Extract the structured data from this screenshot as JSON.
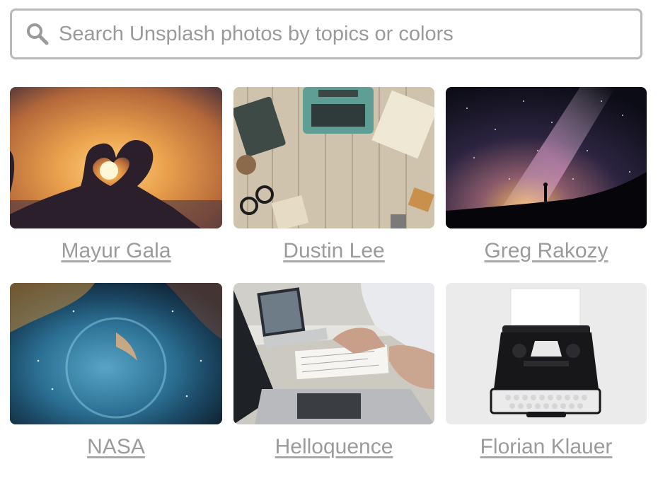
{
  "search": {
    "placeholder": "Search Unsplash photos by topics or colors",
    "icon": "search-icon"
  },
  "photos": [
    {
      "author": "Mayur Gala",
      "subject": "heart-hands-sunset"
    },
    {
      "author": "Dustin Lee",
      "subject": "typewriter-on-wood-desk"
    },
    {
      "author": "Greg Rakozy",
      "subject": "milky-way-silhouette"
    },
    {
      "author": "NASA",
      "subject": "bubble-nebula"
    },
    {
      "author": "Helloquence",
      "subject": "laptops-and-notes"
    },
    {
      "author": "Florian Klauer",
      "subject": "vintage-typewriter"
    }
  ]
}
